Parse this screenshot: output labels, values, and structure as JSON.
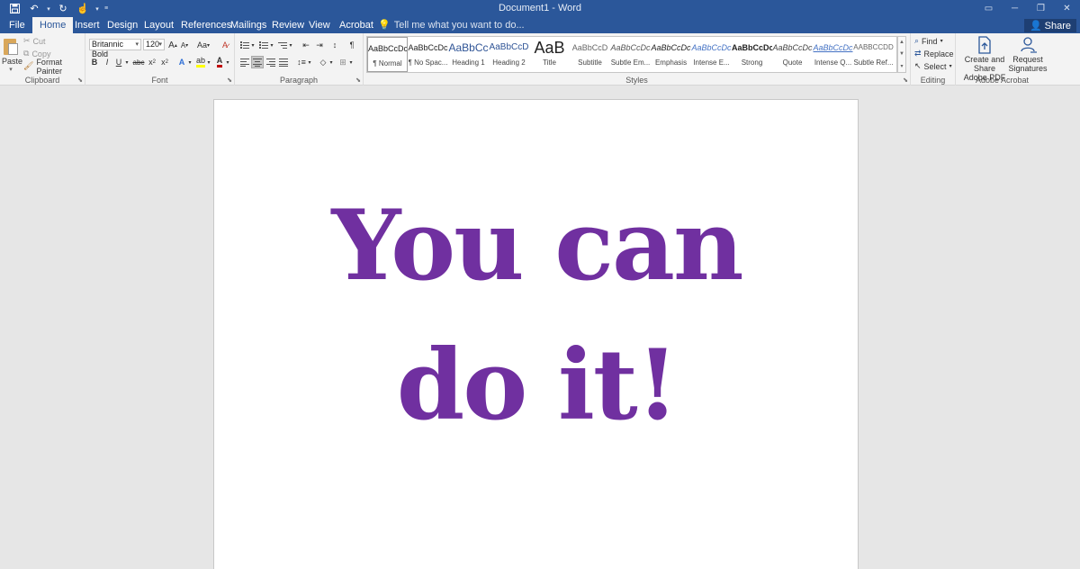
{
  "window": {
    "title": "Document1 - Word"
  },
  "quick_access": [
    "save-icon",
    "undo-icon",
    "redo-icon",
    "touch-mode-icon",
    "customize-icon"
  ],
  "tabs": [
    {
      "label": "File",
      "active": false
    },
    {
      "label": "Home",
      "active": true
    },
    {
      "label": "Insert",
      "active": false
    },
    {
      "label": "Design",
      "active": false
    },
    {
      "label": "Layout",
      "active": false
    },
    {
      "label": "References",
      "active": false
    },
    {
      "label": "Mailings",
      "active": false
    },
    {
      "label": "Review",
      "active": false
    },
    {
      "label": "View",
      "active": false
    },
    {
      "label": "Acrobat",
      "active": false
    }
  ],
  "tell_me": "Tell me what you want to do...",
  "share_label": "Share",
  "clipboard": {
    "paste": "Paste",
    "cut": "Cut",
    "copy": "Copy",
    "format_painter": "Format Painter",
    "group_label": "Clipboard"
  },
  "font": {
    "name": "Britannic Bold",
    "size": "120",
    "grow": "A",
    "shrink": "A",
    "case": "Aa",
    "bold": "B",
    "italic": "I",
    "underline": "U",
    "strikethrough": "abc",
    "subscript": "x",
    "superscript": "x",
    "group_label": "Font"
  },
  "paragraph": {
    "pilcrow": "¶",
    "group_label": "Paragraph"
  },
  "styles": {
    "group_label": "Styles",
    "items": [
      {
        "preview": "AaBbCcDc",
        "name": "¶ Normal",
        "selected": true
      },
      {
        "preview": "AaBbCcDc",
        "name": "¶ No Spac...",
        "selected": false
      },
      {
        "preview": "AaBbCc",
        "name": "Heading 1",
        "selected": false
      },
      {
        "preview": "AaBbCcD",
        "name": "Heading 2",
        "selected": false
      },
      {
        "preview": "AaB",
        "name": "Title",
        "selected": false
      },
      {
        "preview": "AaBbCcD",
        "name": "Subtitle",
        "selected": false
      },
      {
        "preview": "AaBbCcDc",
        "name": "Subtle Em...",
        "selected": false
      },
      {
        "preview": "AaBbCcDc",
        "name": "Emphasis",
        "selected": false
      },
      {
        "preview": "AaBbCcDc",
        "name": "Intense E...",
        "selected": false
      },
      {
        "preview": "AaBbCcDc",
        "name": "Strong",
        "selected": false
      },
      {
        "preview": "AaBbCcDc",
        "name": "Quote",
        "selected": false
      },
      {
        "preview": "AaBbCcDc",
        "name": "Intense Q...",
        "selected": false
      },
      {
        "preview": "AABBCCDD",
        "name": "Subtle Ref...",
        "selected": false
      }
    ]
  },
  "editing": {
    "find": "Find",
    "replace": "Replace",
    "select": "Select",
    "group_label": "Editing"
  },
  "acrobat": {
    "create_share": [
      "Create and Share",
      "Adobe PDF"
    ],
    "request": [
      "Request",
      "Signatures"
    ],
    "group_label": "Adobe Acrobat"
  },
  "document": {
    "line1": "You can",
    "line2": "do it!",
    "text_color": "#7030a0"
  },
  "colors": {
    "brand": "#2b579a",
    "text_accent": "#7030a0",
    "highlight": "#ffff00",
    "font_color": "#c00000"
  }
}
